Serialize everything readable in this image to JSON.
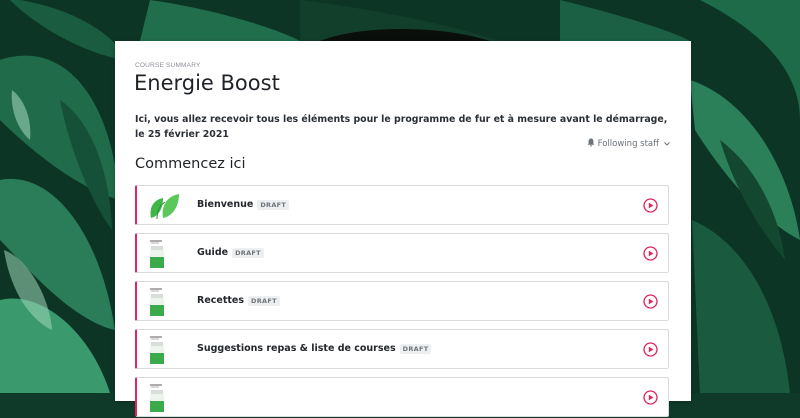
{
  "course": {
    "eyebrow": "COURSE SUMMARY",
    "title": "Energie Boost",
    "description": "Ici, vous allez recevoir tous les éléments pour le programme de fur et à mesure avant le démarrage, le 25 février 2021",
    "follow_label": "Following staff"
  },
  "section": {
    "title": "Commencez ici"
  },
  "lessons": [
    {
      "name": "Bienvenue",
      "badge": "DRAFT",
      "thumb": "leaf-logo"
    },
    {
      "name": "Guide",
      "badge": "DRAFT",
      "thumb": "product-jar"
    },
    {
      "name": "Recettes",
      "badge": "DRAFT",
      "thumb": "product-jar"
    },
    {
      "name": "Suggestions repas & liste de courses",
      "badge": "DRAFT",
      "thumb": "product-jar"
    },
    {
      "name": "",
      "badge": "",
      "thumb": "product-jar"
    }
  ],
  "colors": {
    "accent": "#e0245e",
    "background": "#0f3a2a"
  },
  "icons": {
    "follow": "bell-icon",
    "dropdown": "chevron-down-icon",
    "play": "play-circle-icon"
  }
}
